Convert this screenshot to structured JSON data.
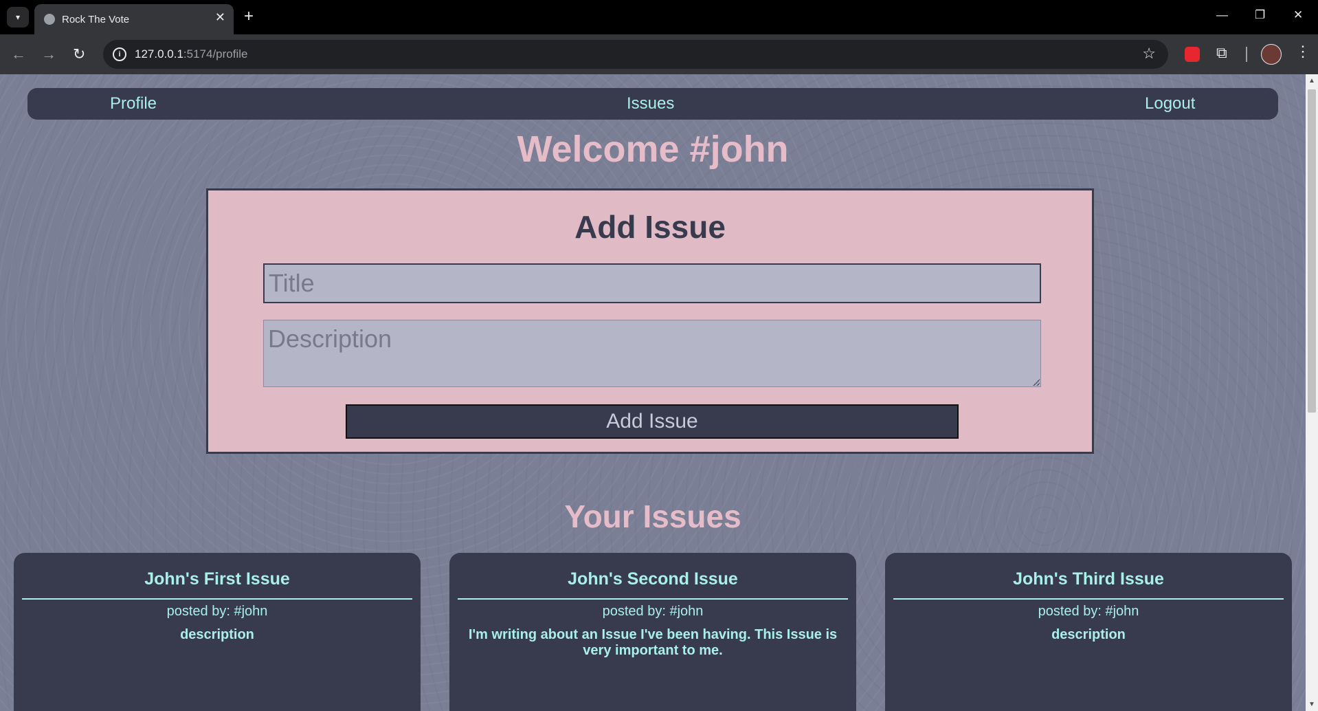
{
  "browser": {
    "tab_title": "Rock The Vote",
    "tab_close": "✕",
    "new_tab": "+",
    "url_host": "127.0.0.1",
    "url_rest": ":5174/profile",
    "controls": {
      "minimize": "—",
      "restore": "❐",
      "close": "✕"
    }
  },
  "nav": {
    "profile": "Profile",
    "issues": "Issues",
    "logout": "Logout"
  },
  "welcome": "Welcome #john",
  "form": {
    "title": "Add Issue",
    "title_placeholder": "Title",
    "description_placeholder": "Description",
    "submit_label": "Add Issue"
  },
  "your_issues_heading": "Your Issues",
  "issues": [
    {
      "title": "John's First Issue",
      "posted_by": "posted by: #john",
      "description": "description"
    },
    {
      "title": "John's Second Issue",
      "posted_by": "posted by: #john",
      "description": "I'm writing about an Issue I've been having. This Issue is very important to me."
    },
    {
      "title": "John's Third Issue",
      "posted_by": "posted by: #john",
      "description": "description"
    }
  ],
  "colors": {
    "page_bg": "#7a7f96",
    "nav_bg": "#383a4d",
    "accent_pink": "#e6bcc8",
    "accent_teal": "#a8f0e8",
    "form_bg": "#e0bac4"
  }
}
